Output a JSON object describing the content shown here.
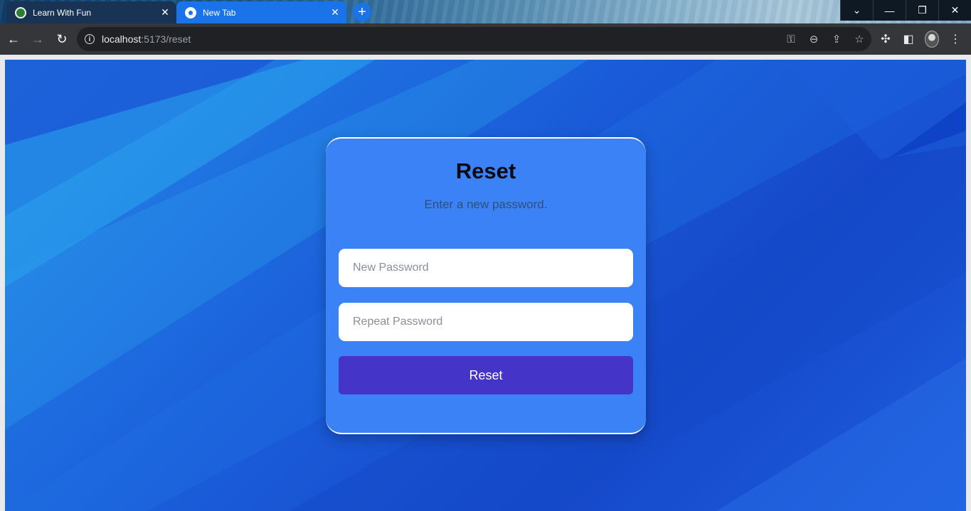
{
  "browser": {
    "tabs": [
      {
        "title": "Learn With Fun",
        "active": false
      },
      {
        "title": "New Tab",
        "active": true
      }
    ],
    "new_tab_label": "+",
    "address": {
      "host": "localhost",
      "path": ":5173/reset"
    },
    "window_controls": {
      "dropdown": "⌄",
      "minimize": "—",
      "restore": "❐",
      "close": "✕"
    }
  },
  "form": {
    "title": "Reset",
    "subtitle": "Enter a new password.",
    "new_password_placeholder": "New Password",
    "repeat_password_placeholder": "Repeat Password",
    "submit_label": "Reset"
  },
  "colors": {
    "card": "#3b82f6",
    "submit_button": "#4434c8",
    "active_tab": "#1a73e8"
  }
}
